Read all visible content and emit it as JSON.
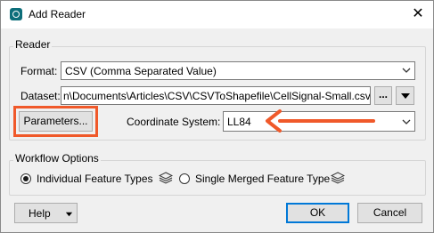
{
  "window": {
    "title": "Add Reader",
    "close_glyph": "✕"
  },
  "reader": {
    "group_label": "Reader",
    "format_label": "Format:",
    "format_value": "CSV (Comma Separated Value)",
    "dataset_label": "Dataset:",
    "dataset_value": "n\\Documents\\Articles\\CSV\\CSVToShapefile\\CellSignal-Small.csv",
    "browse_label": "...",
    "parameters_label": "Parameters...",
    "coord_label": "Coordinate System:",
    "coord_value": "LL84"
  },
  "workflow": {
    "group_label": "Workflow Options",
    "opt_individual": "Individual Feature Types",
    "opt_single": "Single Merged Feature Type",
    "selected": "Individual Feature Types"
  },
  "footer": {
    "help_label": "Help",
    "ok_label": "OK",
    "cancel_label": "Cancel"
  },
  "colors": {
    "highlight": "#f0592a",
    "accent": "#0078d7",
    "icon": "#0d6e7a"
  },
  "icons": [
    "app-icon",
    "close-icon",
    "chevron-down-icon",
    "triangle-down-icon",
    "layers-icon",
    "arrow-left-annotation"
  ]
}
